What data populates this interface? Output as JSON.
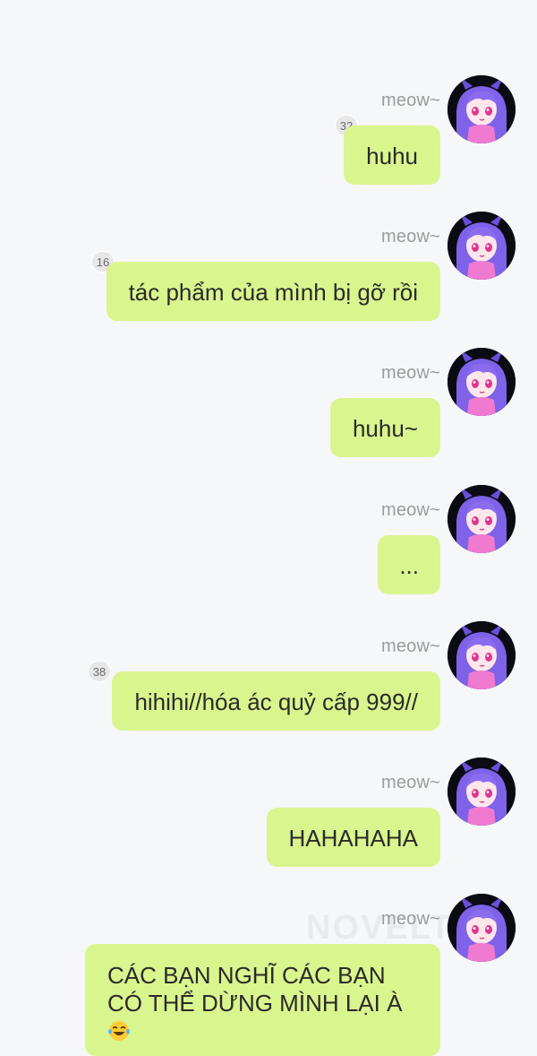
{
  "sender_name": "meow~",
  "watermark": "NOVELTO",
  "messages": [
    {
      "text": "huhu",
      "badge": "32"
    },
    {
      "text": "tác phẩm của mình bị gỡ rồi",
      "badge": "16"
    },
    {
      "text": "huhu~",
      "badge": ""
    },
    {
      "text": "...",
      "badge": ""
    },
    {
      "text": "hihihi//hóa ác quỷ cấp 999//",
      "badge": "38"
    },
    {
      "text": "HAHAHAHA",
      "badge": ""
    },
    {
      "text": "CÁC BẠN NGHĨ CÁC BẠN CÓ THỂ DỪNG MÌNH LẠI À",
      "badge": "",
      "emoji": "face-with-tears-of-joy-icon"
    }
  ],
  "colors": {
    "background": "#f6f7f9",
    "bubble": "#d9f58e",
    "sender": "#9b9b9b",
    "badge": "#e7e7e7",
    "avatar_hair": "#8a6cf0",
    "avatar_shirt": "#f07ad0"
  }
}
